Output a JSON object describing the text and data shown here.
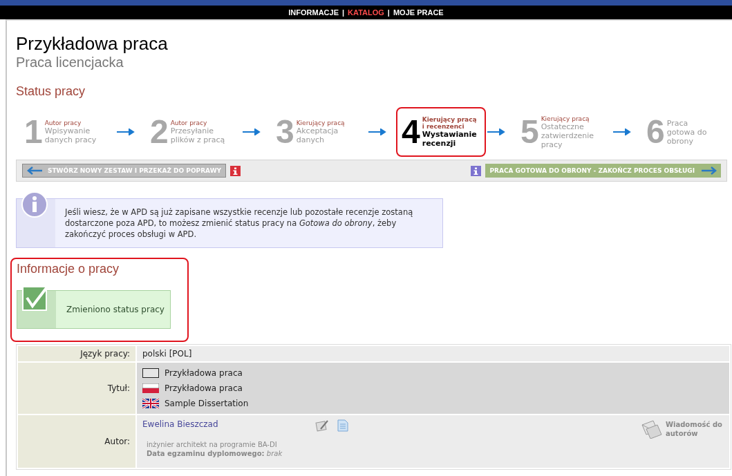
{
  "nav": [
    {
      "kind": "link",
      "label": "INFORMACJE",
      "selected": false
    },
    {
      "kind": "separator",
      "label": "|"
    },
    {
      "kind": "link",
      "label": "KATALOG",
      "selected": true
    },
    {
      "kind": "separator",
      "label": "|"
    },
    {
      "kind": "link",
      "label": "MOJE PRACE",
      "selected": false
    }
  ],
  "title": "Przykładowa praca",
  "subtitle": "Praca licencjacka",
  "status": {
    "heading": "Status pracy",
    "steps": [
      {
        "number": "1",
        "actor": "Autor pracy",
        "label": "Wpisywanie danych pracy",
        "selected": false
      },
      {
        "number": "2",
        "actor": "Autor pracy",
        "label": "Przesyłanie plików z pracą",
        "selected": false
      },
      {
        "number": "3",
        "actor": "Kierujący pracą",
        "label": "Akceptacja danych",
        "selected": false
      },
      {
        "number": "4",
        "actor": "Kierujący pracą i recenzenci",
        "label": "Wystawianie recenzji",
        "selected": true
      },
      {
        "number": "5",
        "actor": "Kierujący pracą",
        "label": "Ostateczne zatwierdzenie pracy",
        "selected": false
      },
      {
        "number": "6",
        "label": "Praca gotowa do obrony",
        "selected": false
      }
    ],
    "back_button": "STWÓRZ NOWY ZESTAW I PRZEKAŻ DO POPRAWY",
    "forward_button": "PRACA GOTOWA DO OBRONY - ZAKOŃCZ PROCES OBSŁUGI"
  },
  "info": "Jeśli wiesz, że w APD są już zapisane wszystkie recenzje lub pozostałe recenzje zostaną dostarczone poza APD, to możesz zmienić status pracy na *Gotowa do obrony*, żeby zakończyć proces obsługi w APD.",
  "section": {
    "heading": "Informacje o pracy",
    "highlighted": true,
    "message": "Zmieniono status pracy"
  },
  "table": [
    {
      "kind": "text",
      "label": "Język pracy:",
      "value": "polski [POL]"
    },
    {
      "kind": "titles",
      "label": "Tytuł:",
      "titles": [
        {
          "kind": "blank",
          "text": "Przykładowa praca"
        },
        {
          "kind": "pl",
          "text": "Przykładowa praca"
        },
        {
          "kind": "en",
          "text": "Sample Dissertation"
        }
      ]
    },
    {
      "kind": "author",
      "label": "Autor:",
      "name": "Ewelina Bieszczad",
      "program": "inżynier architekt na programie BA-DI",
      "exam": "**Data egzaminu dyplomowego:** *brak*",
      "message_link": "Wiadomość do autorów"
    }
  ]
}
